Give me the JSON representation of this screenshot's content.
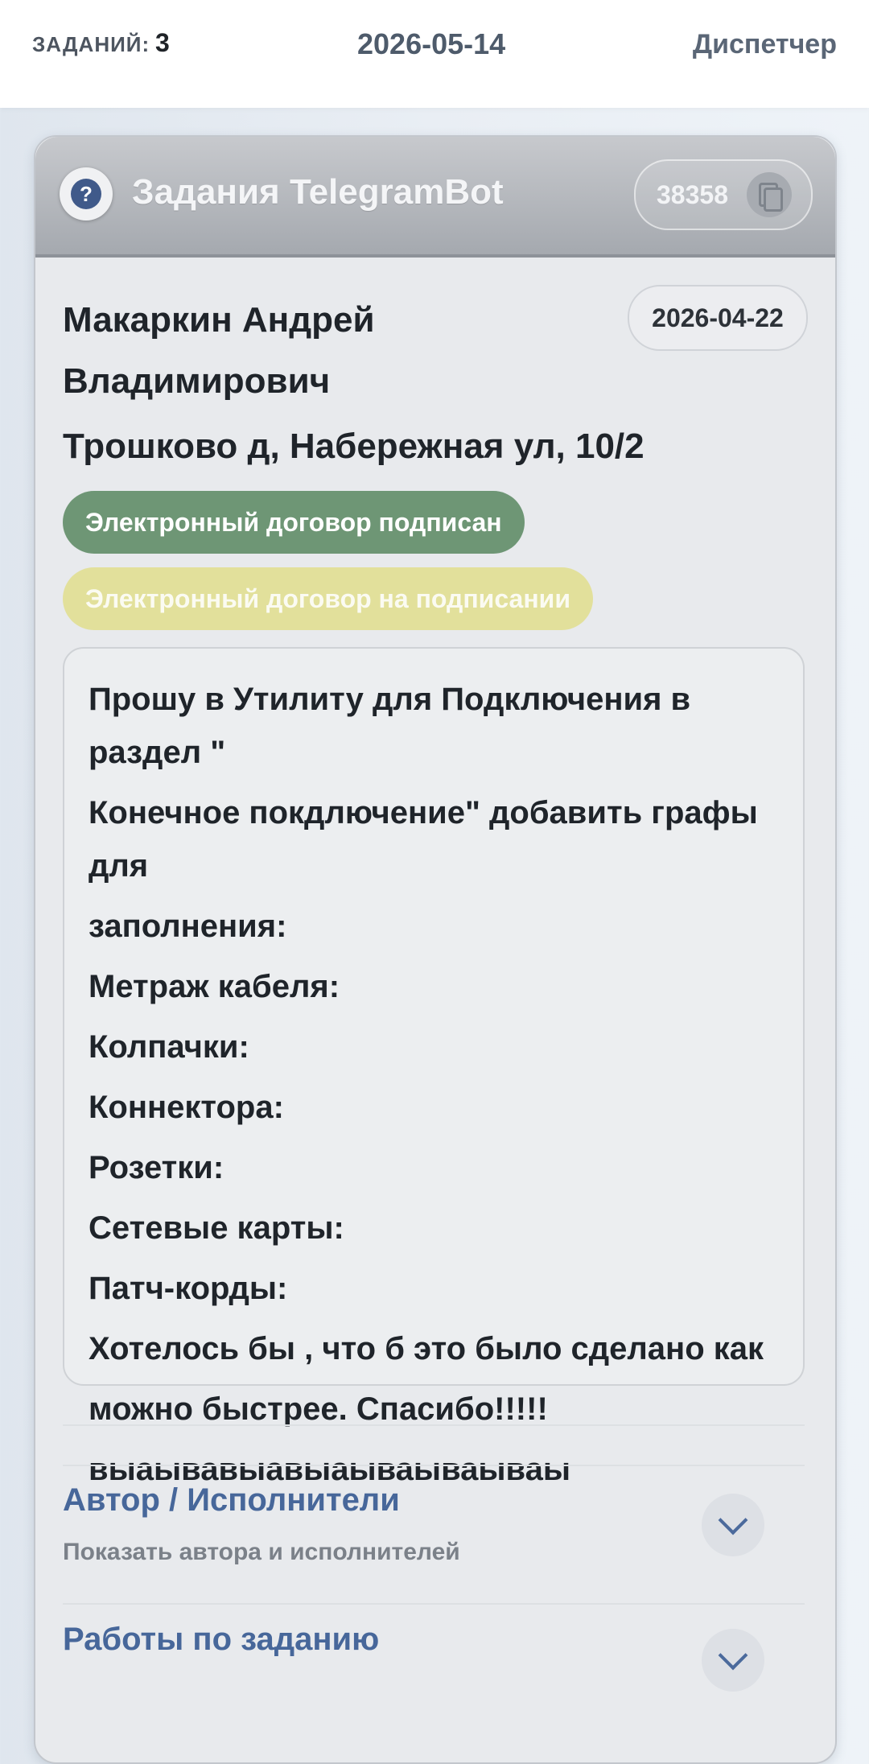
{
  "topbar": {
    "tasks_label": "ЗАДАНИЙ:",
    "tasks_count": "3",
    "date": "2026-05-14",
    "role": "Диспетчер"
  },
  "card": {
    "help_icon": "?",
    "title": "Задания TelegramBot",
    "id": "38358",
    "copy_icon": "copy-icon",
    "person_name": "Макаркин Андрей Владимирович",
    "date": "2026-04-22",
    "address": "Трошково д, Набережная ул, 10/2",
    "badges": {
      "signed": "Электронный договор подписан",
      "signing": "Электронный договор на подписании"
    },
    "colors": {
      "signed_badge": "#6e9675",
      "signing_badge": "#e2e09b",
      "section_title": "#47679a",
      "help_icon": "#405a8a"
    },
    "message_lines": [
      "Прошу в Утилиту для Подключения в раздел \"",
      "Конечное покдлючение\" добавить графы для",
      "заполнения:",
      "Метраж кабеля:",
      "Колпачки:",
      "Коннектора:",
      "Розетки:",
      "Сетевые карты:",
      "Патч-корды:",
      "Хотелось бы , что б это было сделано как",
      "можно быстрее. Спасибо!!!!!",
      "выаывавыавыаываываываы"
    ]
  },
  "sections": {
    "authors": {
      "title": "Автор / Исполнители",
      "subtitle": "Показать автора и исполнителей"
    },
    "works": {
      "title": "Работы по заданию"
    }
  }
}
